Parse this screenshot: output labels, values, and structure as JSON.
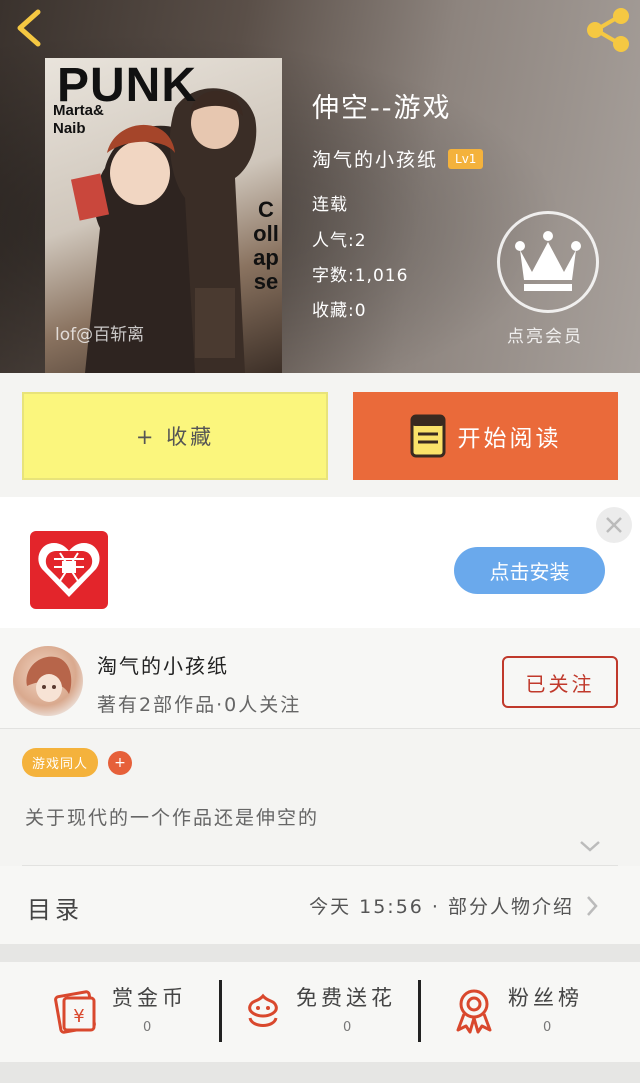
{
  "hero": {
    "cover": {
      "title": "PUNK",
      "subtitle": "Marta&\nNaib",
      "side_text": "Collapse",
      "watermark": "lof@百斩离"
    },
    "book_title": "伸空--游戏",
    "author": "淘气的小孩纸",
    "level": "Lv1",
    "status": "连载",
    "popularity": "人气:2",
    "word_count": "字数:1,016",
    "favorites": "收藏:0",
    "vip_label": "点亮会员"
  },
  "actions": {
    "favorite_label": "+ 收藏",
    "read_label": "开始阅读"
  },
  "ad": {
    "install_label": "点击安装"
  },
  "author_card": {
    "name": "淘气的小孩纸",
    "stats": "著有2部作品·0人关注",
    "follow_label": "已关注"
  },
  "tags": [
    "游戏同人"
  ],
  "tag_add": "+",
  "description": "关于现代的一个作品还是伸空的",
  "toc": {
    "title": "目录",
    "latest": "今天 15:56 · 部分人物介绍"
  },
  "rewards": [
    {
      "label": "赏金币",
      "count": "0",
      "icon": "gold-coin-icon"
    },
    {
      "label": "免费送花",
      "count": "0",
      "icon": "flower-icon"
    },
    {
      "label": "粉丝榜",
      "count": "0",
      "icon": "fan-ranking-icon"
    }
  ],
  "colors": {
    "favorite_bg": "#fbf67d",
    "read_bg": "#ea6a3a",
    "install_bg": "#6aa9ec",
    "follow_border": "#c0392b",
    "tag_bg": "#f4b23c",
    "level_bg": "#f4b23c",
    "accent_icon": "#d9482d"
  }
}
